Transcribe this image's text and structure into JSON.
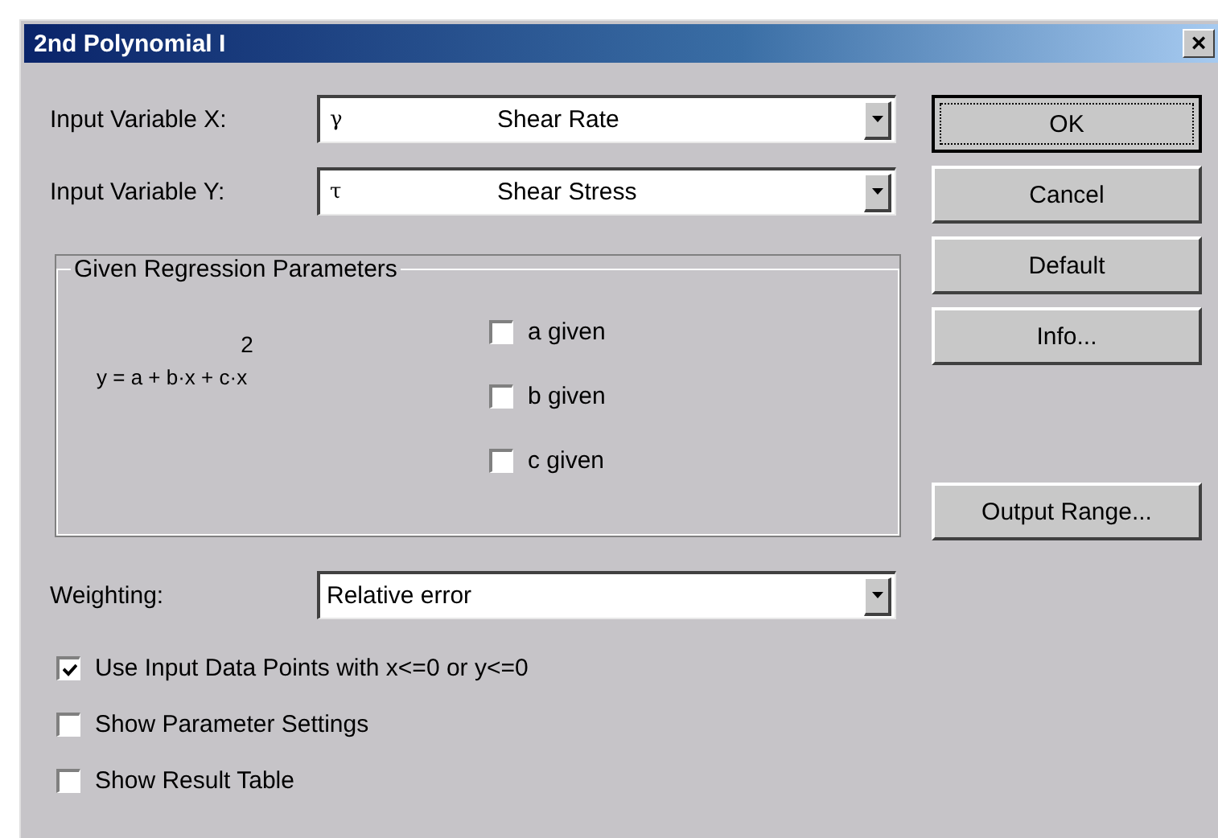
{
  "window": {
    "title": "2nd Polynomial I",
    "close": "×"
  },
  "inputs": [
    {
      "label": "Input Variable X:",
      "symbol": "γ",
      "value": "Shear Rate"
    },
    {
      "label": "Input Variable Y:",
      "symbol": "τ",
      "value": "Shear Stress"
    }
  ],
  "group": {
    "title": "Given Regression Parameters",
    "formula": "y = a + b·x + c·x$^{2}$",
    "checks": [
      {
        "label": "a given",
        "checked": false
      },
      {
        "label": "b given",
        "checked": false
      },
      {
        "label": "c given",
        "checked": false
      }
    ]
  },
  "buttons": [
    {
      "label": "OK",
      "kind": "default"
    },
    {
      "label": "Cancel",
      "kind": "normal"
    },
    {
      "label": "Default",
      "kind": "normal"
    },
    {
      "label": "Info...",
      "kind": "normal"
    },
    {
      "label": "Output Range...",
      "kind": "spaced"
    }
  ],
  "weighting": {
    "label": "Weighting:",
    "value": "Relative error"
  },
  "options": [
    {
      "label": "Use Input Data Points with x<=0 or y<=0",
      "checked": true
    },
    {
      "label": "Show Parameter Settings",
      "checked": false
    },
    {
      "label": "Show Result Table",
      "checked": false
    }
  ]
}
